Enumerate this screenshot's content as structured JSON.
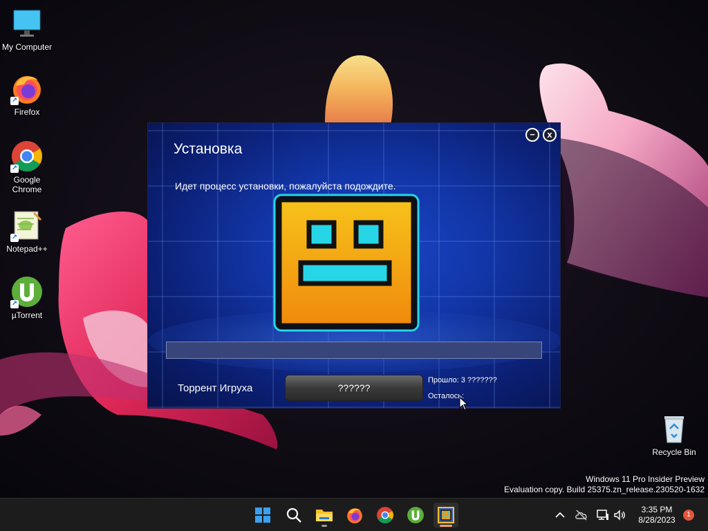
{
  "desktop": {
    "icons": [
      {
        "label": "My Computer"
      },
      {
        "label": "Firefox"
      },
      {
        "label": "Google Chrome"
      },
      {
        "label": "Notepad++"
      },
      {
        "label": "µTorrent"
      },
      {
        "label": "Recycle Bin"
      }
    ],
    "watermark": {
      "line1": "Windows 11 Pro Insider Preview",
      "line2": "Evaluation copy. Build 25375.zn_release.230520-1632"
    }
  },
  "installer": {
    "title": "Установка",
    "minimize_label": "−",
    "close_label": "x",
    "status": "Идет процесс установки, пожалуйста подождите.",
    "progress": 0,
    "game_name": "Торрент Игруха",
    "button_label": "??????",
    "elapsed": "Прошло:  3 ???????",
    "remaining": "Осталось:"
  },
  "taskbar": {
    "apps": [
      "start-icon",
      "search-icon",
      "file-explorer-icon",
      "firefox-icon",
      "chrome-icon",
      "utorrent-icon",
      "installer-app-icon"
    ],
    "clock_time": "3:35 PM",
    "clock_date": "8/28/2023",
    "notification_count": "1"
  },
  "colors": {
    "window_blue": "#1236a8",
    "logo_orange": "#f39a12",
    "logo_cyan": "#27d6e6",
    "taskbar": "#1c1c1c"
  }
}
